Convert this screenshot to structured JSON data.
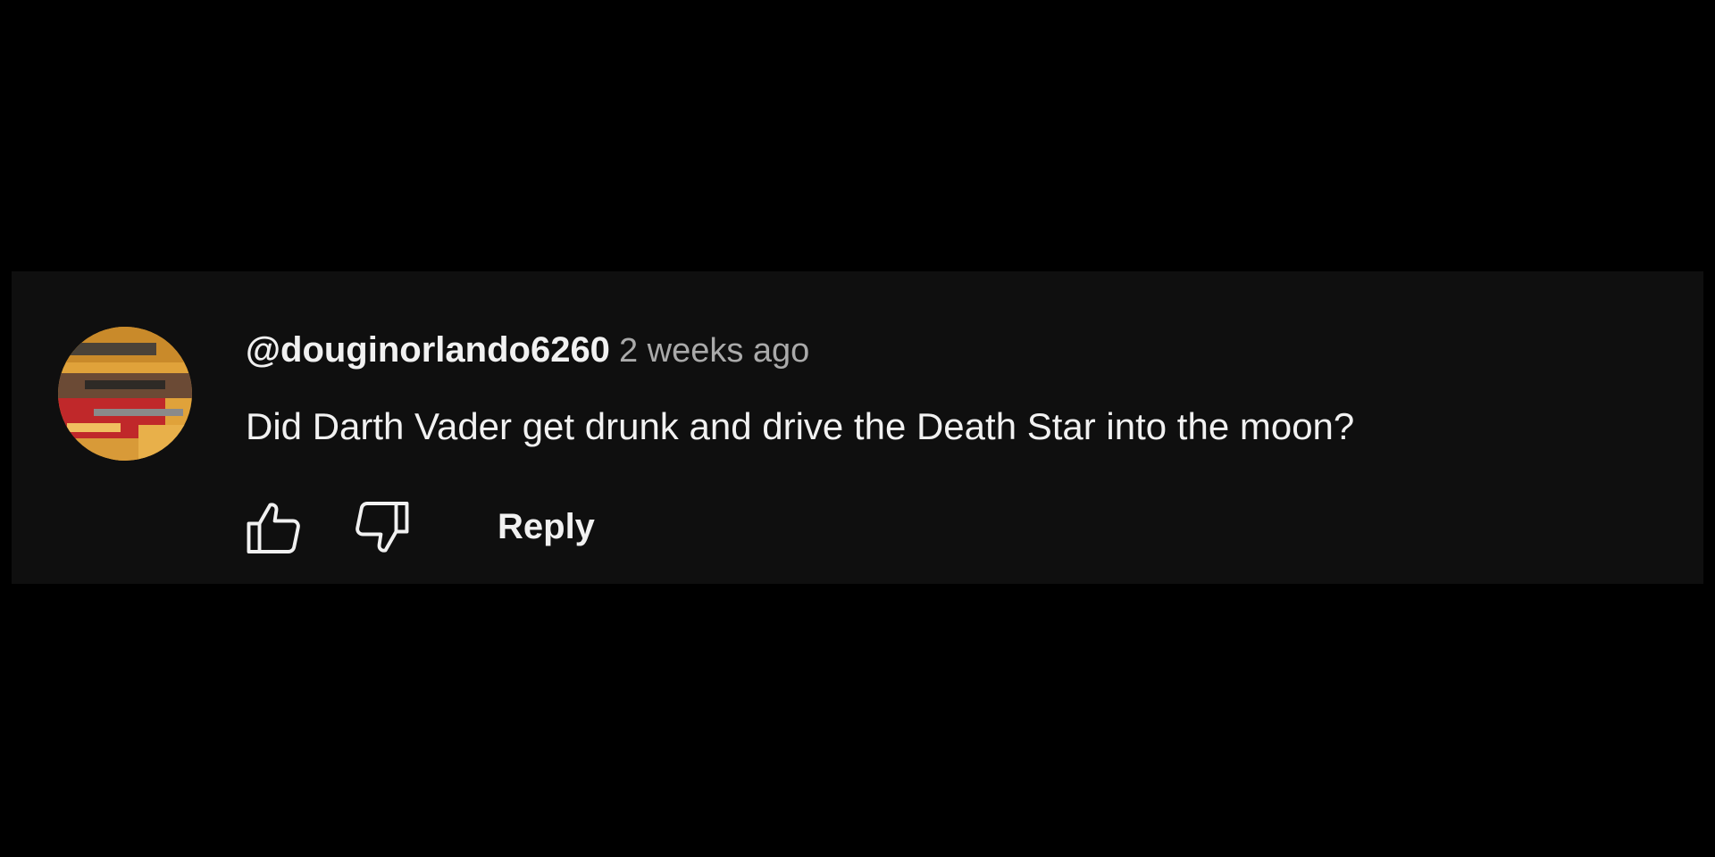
{
  "comment": {
    "author": "@douginorlando6260",
    "timestamp": "2 weeks ago",
    "text": "Did Darth Vader get drunk and drive the Death Star into the moon?",
    "avatar_icon": "user-avatar"
  },
  "actions": {
    "like_icon": "thumbs-up-icon",
    "dislike_icon": "thumbs-down-icon",
    "reply_label": "Reply"
  },
  "colors": {
    "page_background": "#000000",
    "card_background": "#0f0f0f",
    "primary_text": "#f1f1f1",
    "secondary_text": "#aaaaaa"
  }
}
